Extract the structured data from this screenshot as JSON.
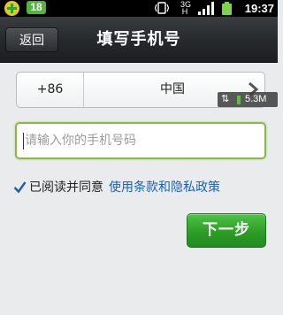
{
  "status_bar": {
    "badge": "18",
    "network": "3G H",
    "clock": "19:37"
  },
  "title_bar": {
    "back_label": "返回",
    "title": "填写手机号"
  },
  "country_selector": {
    "code": "+86",
    "country": "中国"
  },
  "traffic_overlay": {
    "arrows": "⇅",
    "value": "5.3M"
  },
  "phone_input": {
    "placeholder": "请输入你的手机号码",
    "value": ""
  },
  "agreement": {
    "checked": true,
    "text": "已阅读并同意",
    "link": "使用条款和隐私政策"
  },
  "next_button": {
    "label": "下一步"
  },
  "colors": {
    "accent_green": "#2c9d26",
    "link_blue": "#1a62b8",
    "input_focus": "#86b94a"
  }
}
